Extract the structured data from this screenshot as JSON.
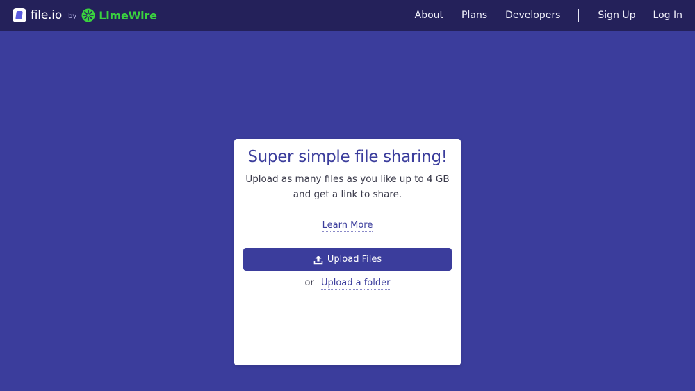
{
  "header": {
    "brand_name": "file.io",
    "brand_by": "by",
    "partner_name": "LimeWire",
    "nav": {
      "about": "About",
      "plans": "Plans",
      "developers": "Developers",
      "sign_up": "Sign Up",
      "log_in": "Log In"
    }
  },
  "card": {
    "title": "Super simple file sharing!",
    "subtitle": "Upload as many files as you like up to 4 GB and get a link to share.",
    "learn_more": "Learn More",
    "upload_button": "Upload Files",
    "or_text": "or",
    "upload_folder": "Upload a folder"
  },
  "colors": {
    "background": "#3b3d9c",
    "header": "#24215a",
    "accent": "#3b3d9c",
    "limewire_green": "#3ad23f"
  },
  "icons": {
    "brand": "file-io-logo-icon",
    "partner": "limewire-logo-icon",
    "upload": "upload-icon"
  }
}
